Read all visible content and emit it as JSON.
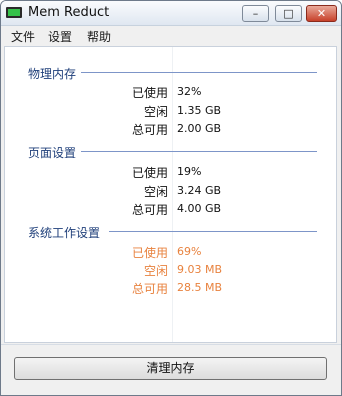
{
  "window": {
    "title": "Mem Reduct",
    "app_icon": "memory-chip-icon"
  },
  "controls": {
    "minimize": "–",
    "maximize": "□",
    "close": "✕"
  },
  "menu": {
    "items": [
      "文件",
      "设置",
      "帮助"
    ]
  },
  "sections": [
    {
      "title": "物理内存",
      "rows": [
        {
          "label": "已使用",
          "value": "32%"
        },
        {
          "label": "空闲",
          "value": "1.35 GB"
        },
        {
          "label": "总可用",
          "value": "2.00 GB"
        }
      ]
    },
    {
      "title": "页面设置",
      "rows": [
        {
          "label": "已使用",
          "value": "19%"
        },
        {
          "label": "空闲",
          "value": "3.24 GB"
        },
        {
          "label": "总可用",
          "value": "4.00 GB"
        }
      ]
    },
    {
      "title": "系统工作设置",
      "highlight_color": "#e8823e",
      "rows": [
        {
          "label": "已使用",
          "value": "69%"
        },
        {
          "label": "空闲",
          "value": "9.03 MB"
        },
        {
          "label": "总可用",
          "value": "28.5 MB"
        }
      ]
    }
  ],
  "actions": {
    "clear_memory": "清理内存"
  }
}
